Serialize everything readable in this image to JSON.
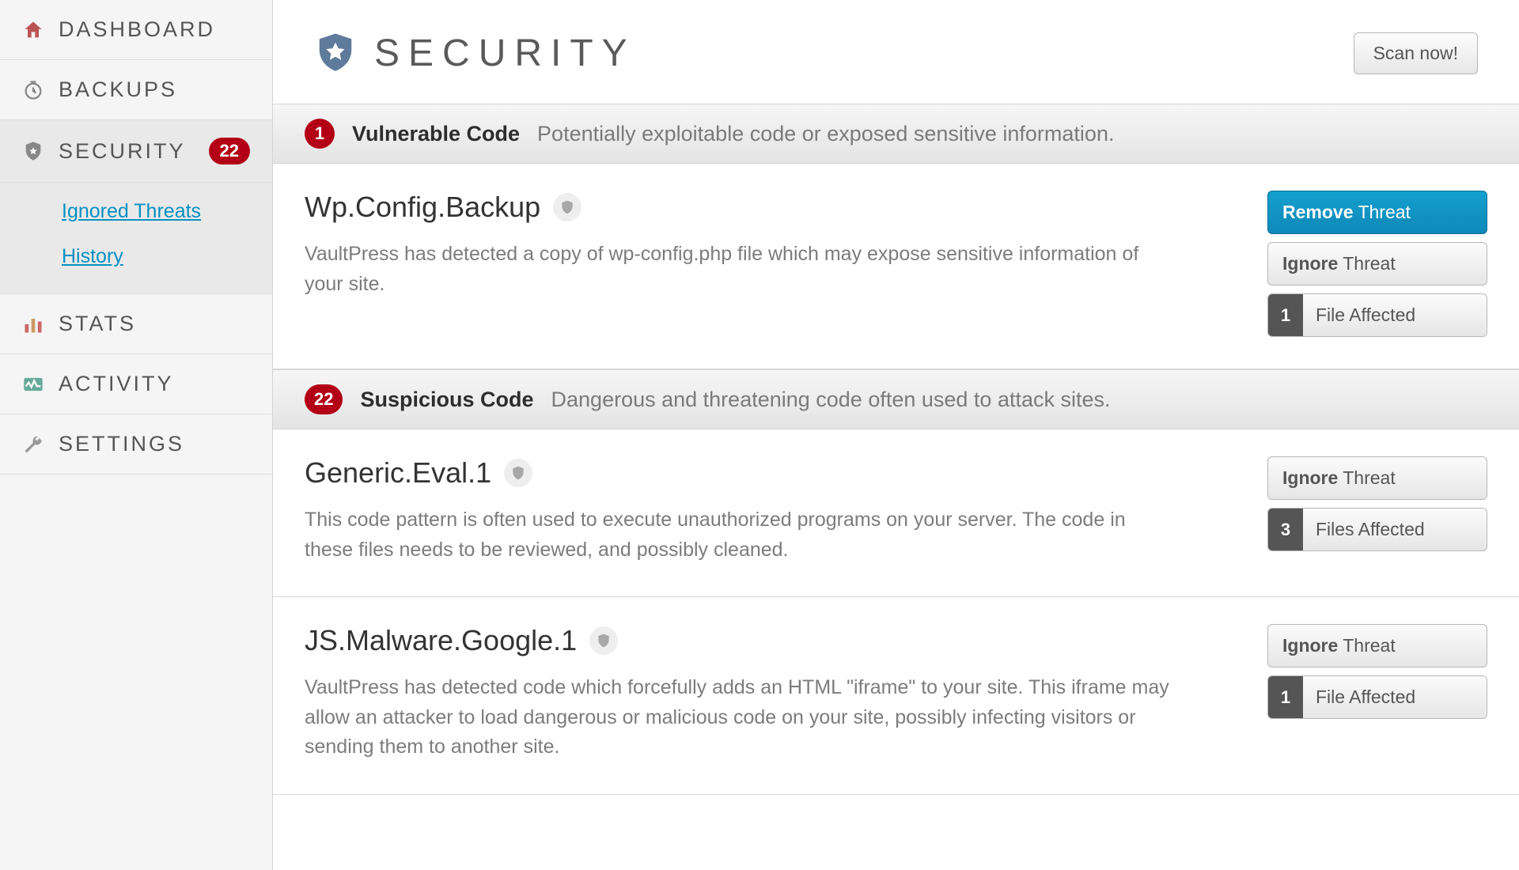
{
  "sidebar": {
    "items": [
      {
        "label": "DASHBOARD",
        "icon": "home"
      },
      {
        "label": "BACKUPS",
        "icon": "clock"
      },
      {
        "label": "SECURITY",
        "icon": "shield",
        "badge": "22",
        "active": true,
        "subitems": [
          {
            "label": "Ignored Threats"
          },
          {
            "label": "History"
          }
        ]
      },
      {
        "label": "STATS",
        "icon": "bars"
      },
      {
        "label": "ACTIVITY",
        "icon": "activity"
      },
      {
        "label": "SETTINGS",
        "icon": "wrench"
      }
    ]
  },
  "header": {
    "title": "SECURITY",
    "scan_button": "Scan now!"
  },
  "sections": [
    {
      "count": "1",
      "title": "Vulnerable Code",
      "desc": "Potentially exploitable code or exposed sensitive information.",
      "threats": [
        {
          "name": "Wp.Config.Backup",
          "desc": "VaultPress has detected a copy of wp-config.php file which may expose sensitive information of your site.",
          "remove": {
            "bold": "Remove",
            "rest": " Threat"
          },
          "ignore": {
            "bold": "Ignore",
            "rest": " Threat"
          },
          "files": {
            "count": "1",
            "label": "File Affected"
          }
        }
      ]
    },
    {
      "count": "22",
      "title": "Suspicious Code",
      "desc": "Dangerous and threatening code often used to attack sites.",
      "threats": [
        {
          "name": "Generic.Eval.1",
          "desc": "This code pattern is often used to execute unauthorized programs on your server. The code in these files needs to be reviewed, and possibly cleaned.",
          "ignore": {
            "bold": "Ignore",
            "rest": " Threat"
          },
          "files": {
            "count": "3",
            "label": "Files Affected"
          }
        },
        {
          "name": "JS.Malware.Google.1",
          "desc": "VaultPress has detected code which forcefully adds an HTML \"iframe\" to your site. This iframe may allow an attacker to load dangerous or malicious code on your site, possibly infecting visitors or sending them to another site.",
          "ignore": {
            "bold": "Ignore",
            "rest": " Threat"
          },
          "files": {
            "count": "1",
            "label": "File Affected"
          }
        }
      ]
    }
  ]
}
